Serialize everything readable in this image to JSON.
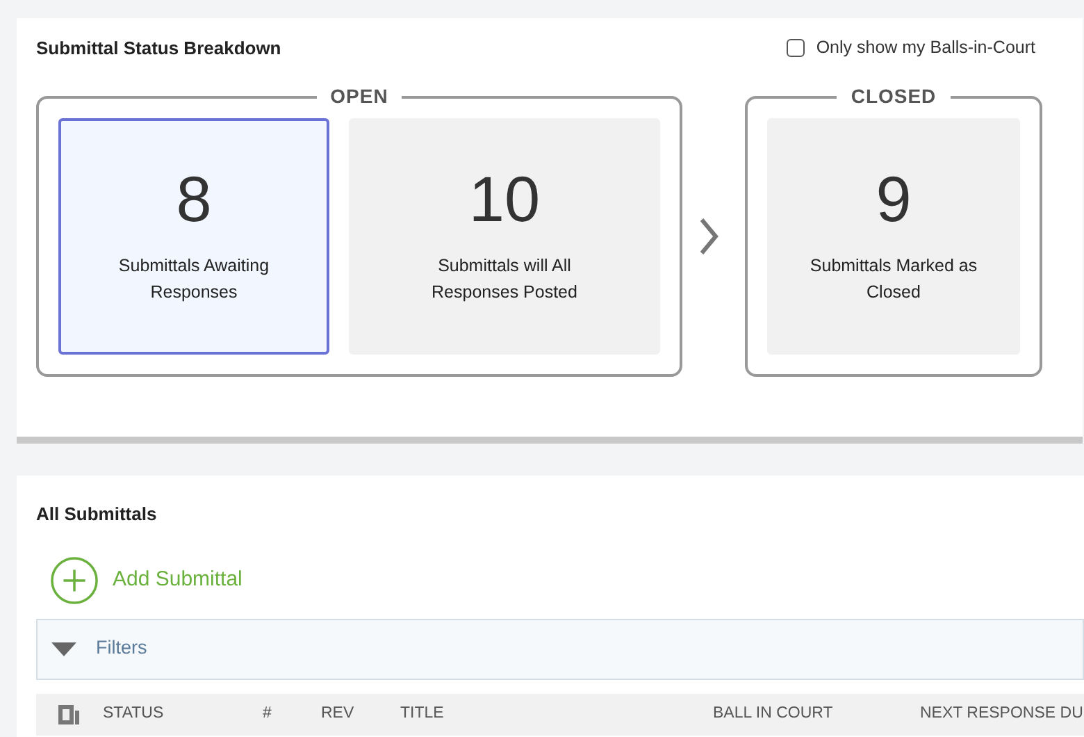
{
  "breakdown": {
    "title": "Submittal Status Breakdown",
    "filter_checkbox": {
      "label": "Only show my Balls-in-Court",
      "checked": false
    },
    "groups": [
      {
        "label": "OPEN",
        "tiles": [
          {
            "count": "8",
            "caption": "Submittals Awaiting Responses",
            "selected": true
          },
          {
            "count": "10",
            "caption": "Submittals will All Responses Posted",
            "selected": false
          }
        ]
      },
      {
        "label": "CLOSED",
        "tiles": [
          {
            "count": "9",
            "caption": "Submittals Marked as Closed",
            "selected": false
          }
        ]
      }
    ]
  },
  "submittals": {
    "title": "All Submittals",
    "add_button": "Add Submittal",
    "filters": {
      "label": "Filters"
    },
    "columns": [
      "STATUS",
      "#",
      "REV",
      "TITLE",
      "BALL IN COURT",
      "NEXT RESPONSE DU"
    ]
  }
}
